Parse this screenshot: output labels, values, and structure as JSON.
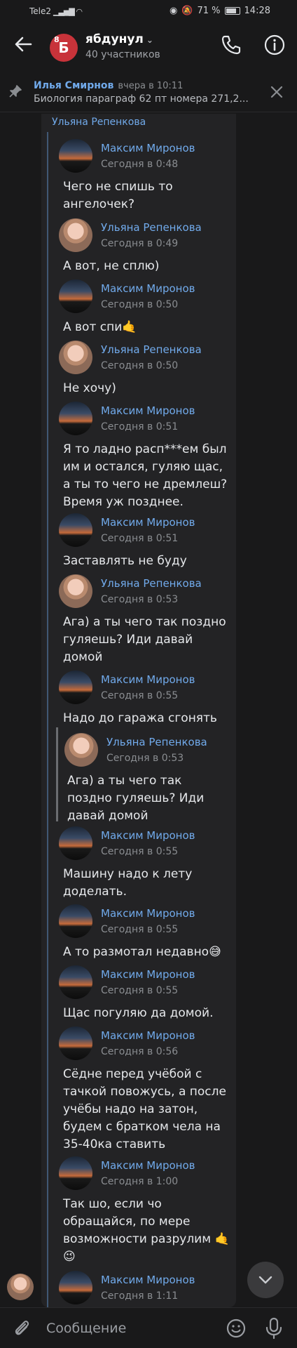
{
  "status": {
    "carrier": "Tele2",
    "battery": "71 %",
    "time": "14:28"
  },
  "header": {
    "avatar_text": "Б",
    "avatar_badge": "8",
    "title": "ябдунул",
    "members": "40 участников"
  },
  "pinned": {
    "author": "Илья Смирнов",
    "time": "вчера в 10:11",
    "text": "Биология параграф 62 пт номера 271,2..."
  },
  "thread": {
    "author": "Ульяна Репенкова"
  },
  "messages": [
    {
      "name": "Максим Миронов",
      "time": "Сегодня в 0:48",
      "text": "Чего не спишь то ангелочек?",
      "avatar": "m"
    },
    {
      "name": "Ульяна Репенкова",
      "time": "Сегодня в 0:49",
      "text": "А вот, не сплю)",
      "avatar": "u"
    },
    {
      "name": "Максим Миронов",
      "time": "Сегодня в 0:50",
      "text": "А вот спи🤙",
      "avatar": "m"
    },
    {
      "name": "Ульяна Репенкова",
      "time": "Сегодня в 0:50",
      "text": "Не хочу)",
      "avatar": "u"
    },
    {
      "name": "Максим Миронов",
      "time": "Сегодня в 0:51",
      "text": "Я то ладно расп***ем был им и остался, гуляю щас, а ты то чего не дремлеш? Время уж позднее.",
      "avatar": "m"
    },
    {
      "name": "Максим Миронов",
      "time": "Сегодня в 0:51",
      "text": "Заставлять не буду",
      "avatar": "m"
    },
    {
      "name": "Ульяна Репенкова",
      "time": "Сегодня в 0:53",
      "text": "Ага) а ты чего так поздно гуляешь? Иди давай домой",
      "avatar": "u"
    },
    {
      "name": "Максим Миронов",
      "time": "Сегодня в 0:55",
      "text": "Надо до гаража сгонять",
      "avatar": "m"
    },
    {
      "name": "Максим Миронов",
      "time": "Сегодня в 0:55",
      "text": "Машину надо к лету доделать.",
      "avatar": "m"
    },
    {
      "name": "Максим Миронов",
      "time": "Сегодня в 0:55",
      "text": "А то размотал недавно😅",
      "avatar": "m"
    },
    {
      "name": "Максим Миронов",
      "time": "Сегодня в 0:55",
      "text": "Щас погуляю да домой.",
      "avatar": "m"
    },
    {
      "name": "Максим Миронов",
      "time": "Сегодня в 0:56",
      "text": "Сёдне перед учёбой с тачкой повожусь, а после учёбы надо на затон, будем с братком чела на 35-40ка ставить",
      "avatar": "m"
    },
    {
      "name": "Максим Миронов",
      "time": "Сегодня в 1:00",
      "text": "Так шо, если чо обращайся, по мере возможности разрулим 🤙😉",
      "avatar": "m"
    },
    {
      "name": "Максим Миронов",
      "time": "Сегодня в 1:11",
      "text": "",
      "avatar": "m"
    }
  ],
  "quote": {
    "name": "Ульяна Репенкова",
    "time": "Сегодня в 0:53",
    "text": "Ага) а ты чего так поздно гуляешь? Иди давай домой"
  },
  "composer": {
    "placeholder": "Сообщение"
  }
}
